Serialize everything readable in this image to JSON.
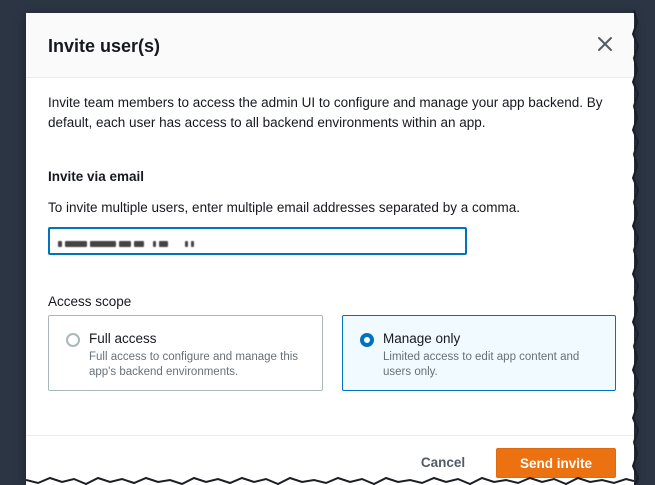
{
  "modal": {
    "title": "Invite user(s)",
    "close_icon": "close-icon",
    "description": "Invite team members to access the admin UI to configure and manage your app backend. By default, each user has access to all backend environments within an app."
  },
  "invite": {
    "section_label": "Invite via email",
    "hint": "To invite multiple users, enter multiple email addresses separated by a comma."
  },
  "scope": {
    "label": "Access scope",
    "options": [
      {
        "title": "Full access",
        "description": "Full access to configure and manage this app's backend environments.",
        "selected": false
      },
      {
        "title": "Manage only",
        "description": "Limited access to edit app content and users only.",
        "selected": true
      }
    ]
  },
  "footer": {
    "cancel_label": "Cancel",
    "send_label": "Send invite"
  },
  "colors": {
    "accent": "#0073bb",
    "primary_button": "#ec7211",
    "page_background": "#2b3544"
  }
}
